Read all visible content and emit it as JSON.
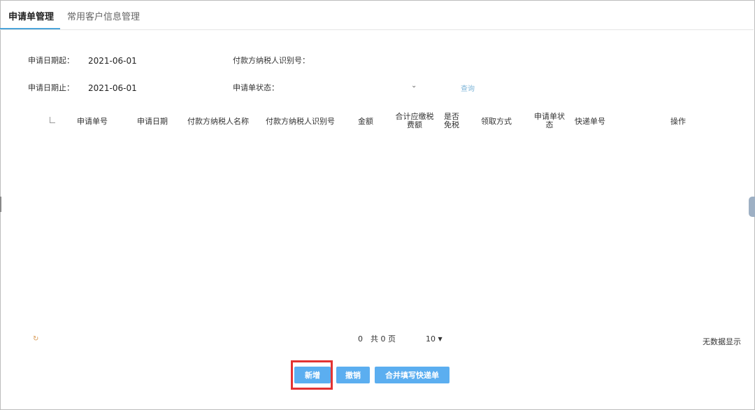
{
  "tabs": [
    {
      "label": "申请单管理",
      "active": true
    },
    {
      "label": "常用客户信息管理",
      "active": false
    }
  ],
  "form": {
    "start_date_label": "申请日期起：",
    "start_date_value": "2021-06-01",
    "end_date_label": "申请日期止：",
    "end_date_value": "2021-06-01",
    "payer_id_label": "付款方纳税人识别号：",
    "status_label": "申请单状态：",
    "status_value": "",
    "query_label": "查询"
  },
  "table": {
    "columns": [
      "申请单号",
      "申请日期",
      "付款方纳税人名称",
      "付款方纳税人识别号",
      "金额",
      "合计应缴税费额",
      "是否免税",
      "领取方式",
      "申请单状态",
      "快递单号",
      "操作"
    ],
    "rows": []
  },
  "pager": {
    "current": "0",
    "total_text": "共 0 页",
    "page_size": "10",
    "empty_text": "无数据显示"
  },
  "buttons": {
    "new_label": "新增",
    "revoke_label": "撤销",
    "merge_label": "合并填写快递单"
  },
  "colors": {
    "accent": "#5baef0",
    "highlight": "#e33333",
    "tab_underline": "#4aa3d9"
  }
}
